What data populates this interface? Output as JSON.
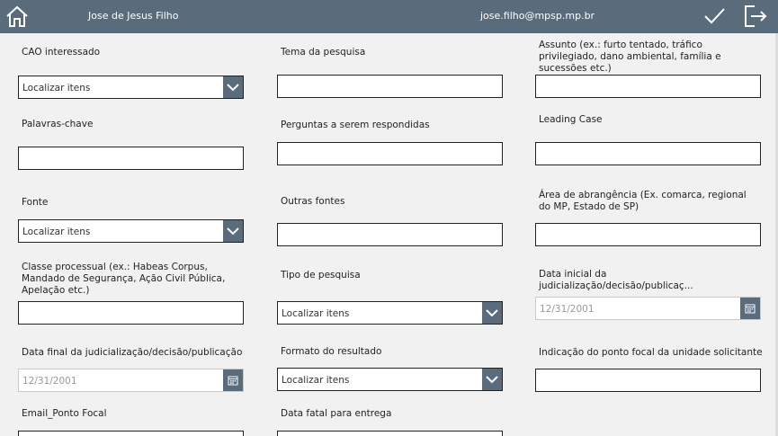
{
  "header": {
    "user_name": "Jose de Jesus Filho",
    "email": "jose.filho@mpsp.mp.br",
    "bar_color": "#5a6b7c"
  },
  "icons": {
    "home": "home-icon",
    "check": "check-icon",
    "exit": "exit-icon",
    "dropdown": "chevron-down-icon",
    "calendar": "calendar-icon"
  },
  "form": {
    "cao": {
      "label": "CAO interessado",
      "placeholder": "Localizar itens"
    },
    "tema": {
      "label": "Tema da pesquisa",
      "value": ""
    },
    "assunto": {
      "label": "Assunto (ex.: furto tentado, tráfico privilegiado, dano ambiental, família e sucessões etc.)",
      "value": ""
    },
    "palavras": {
      "label": "Palavras-chave",
      "value": ""
    },
    "perguntas": {
      "label": "Perguntas a serem respondidas",
      "value": ""
    },
    "leading": {
      "label": "Leading Case",
      "value": ""
    },
    "fonte": {
      "label": "Fonte",
      "placeholder": "Localizar itens"
    },
    "outras": {
      "label": "Outras fontes",
      "value": ""
    },
    "area": {
      "label": "Área de abrangência (Ex. comarca, regional do MP, Estado de SP)",
      "value": ""
    },
    "classe": {
      "label": "Classe processual (ex.: Habeas Corpus, Mandado de Segurança, Ação Civil Pública, Apelação etc.)",
      "value": ""
    },
    "tipo": {
      "label": "Tipo de pesquisa",
      "placeholder": "Localizar itens"
    },
    "data_inicial": {
      "label": "Data inicial da judicialização/decisão/publicaç...",
      "placeholder": "12/31/2001"
    },
    "data_final": {
      "label": "Data final da judicialização/decisão/publicação",
      "placeholder": "12/31/2001"
    },
    "formato": {
      "label": "Formato do resultado",
      "placeholder": "Localizar itens"
    },
    "indicacao": {
      "label": "Indicação do ponto focal da unidade solicitante",
      "value": ""
    },
    "email_focal": {
      "label": "Email_Ponto Focal",
      "value": ""
    },
    "data_fatal": {
      "label": "Data fatal para entrega",
      "value": ""
    }
  }
}
